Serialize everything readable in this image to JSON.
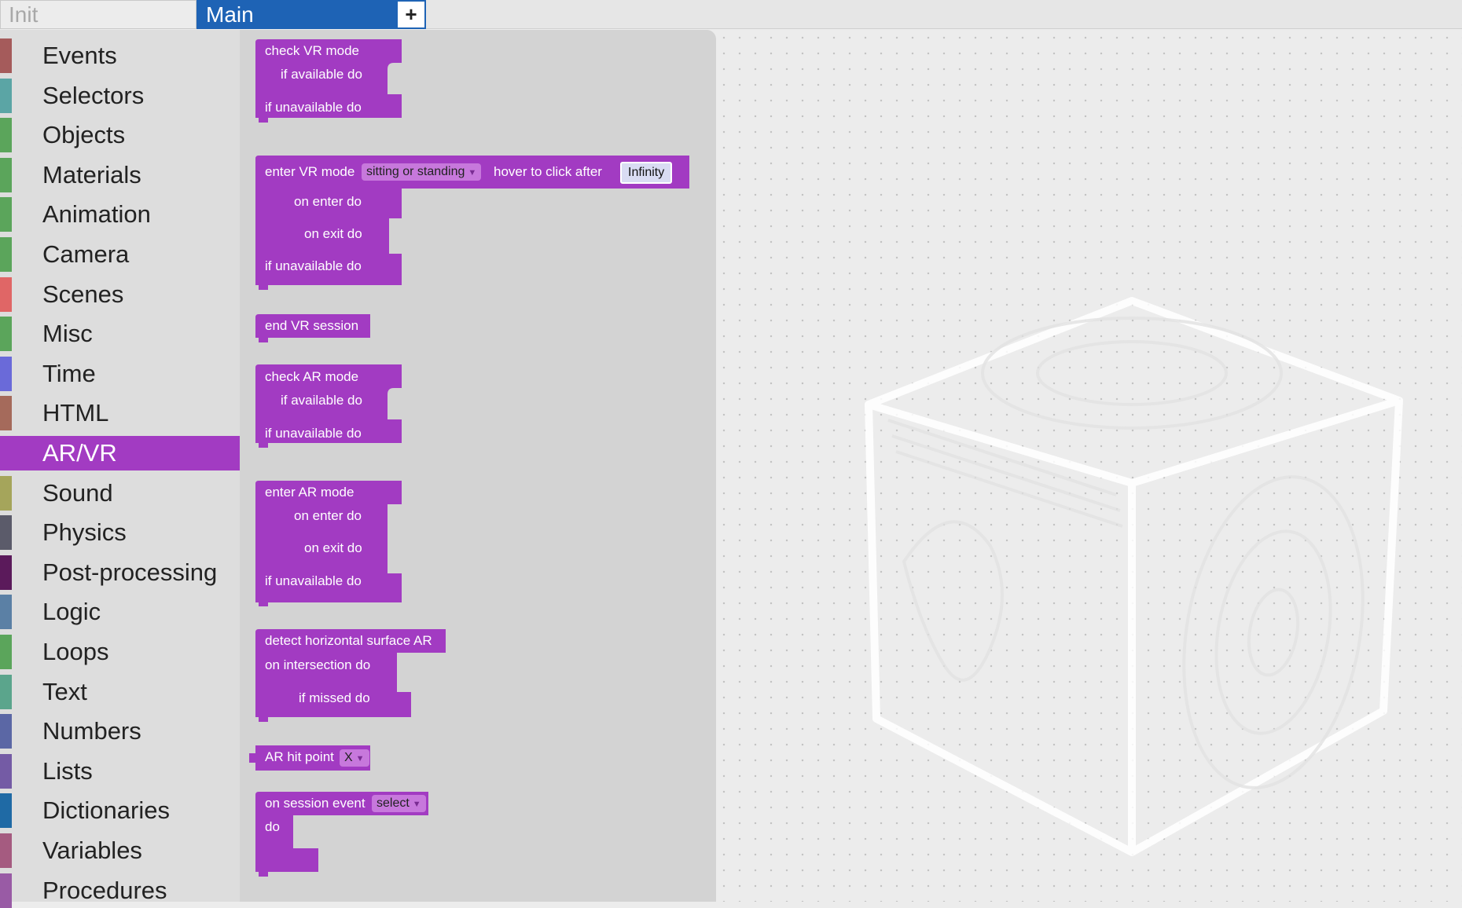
{
  "tabs": {
    "init": "Init",
    "main": "Main",
    "add": "+"
  },
  "categories": [
    {
      "label": "Events",
      "color": "#a55b5b"
    },
    {
      "label": "Selectors",
      "color": "#5ba5a5"
    },
    {
      "label": "Objects",
      "color": "#5ba55b"
    },
    {
      "label": "Materials",
      "color": "#5ba55b"
    },
    {
      "label": "Animation",
      "color": "#5ba55b"
    },
    {
      "label": "Camera",
      "color": "#5ba55b"
    },
    {
      "label": "Scenes",
      "color": "#e06666"
    },
    {
      "label": "Misc",
      "color": "#5ba55b"
    },
    {
      "label": "Time",
      "color": "#6a6ad9"
    },
    {
      "label": "HTML",
      "color": "#a56a5b"
    },
    {
      "label": "AR/VR",
      "color": "#a23bc2"
    },
    {
      "label": "Sound",
      "color": "#a5a55b"
    },
    {
      "label": "Physics",
      "color": "#5b5b6a"
    },
    {
      "label": "Post-processing",
      "color": "#5b1a5b"
    },
    {
      "label": "Logic",
      "color": "#5b80a5"
    },
    {
      "label": "Loops",
      "color": "#5ba55b"
    },
    {
      "label": "Text",
      "color": "#5ba58c"
    },
    {
      "label": "Numbers",
      "color": "#5b67a5"
    },
    {
      "label": "Lists",
      "color": "#745ba5"
    },
    {
      "label": "Dictionaries",
      "color": "#1f6aa5"
    },
    {
      "label": "Variables",
      "color": "#a55b80"
    },
    {
      "label": "Procedures",
      "color": "#995ba5"
    }
  ],
  "selected_category": "AR/VR",
  "blocks": {
    "check_vr": {
      "title": "check VR mode",
      "available": "if available do",
      "unavailable": "if unavailable do"
    },
    "enter_vr": {
      "title": "enter VR mode",
      "mode": "sitting or standing",
      "hover": "hover to click after",
      "hover_value": "Infinity",
      "on_enter": "on enter do",
      "on_exit": "on exit do",
      "unavailable": "if unavailable do"
    },
    "end_vr": {
      "title": "end VR session"
    },
    "check_ar": {
      "title": "check AR mode",
      "available": "if available do",
      "unavailable": "if unavailable do"
    },
    "enter_ar": {
      "title": "enter AR mode",
      "on_enter": "on enter do",
      "on_exit": "on exit do",
      "unavailable": "if unavailable do"
    },
    "detect_ar": {
      "title": "detect horizontal surface AR",
      "intersection": "on intersection do",
      "missed": "if missed do"
    },
    "hit_point": {
      "title": "AR hit point",
      "axis": "X"
    },
    "session_event": {
      "title": "on session event",
      "event": "select",
      "do": "do"
    }
  },
  "colors": {
    "block": "#a23bc2",
    "tab_active": "#1e63b5"
  }
}
